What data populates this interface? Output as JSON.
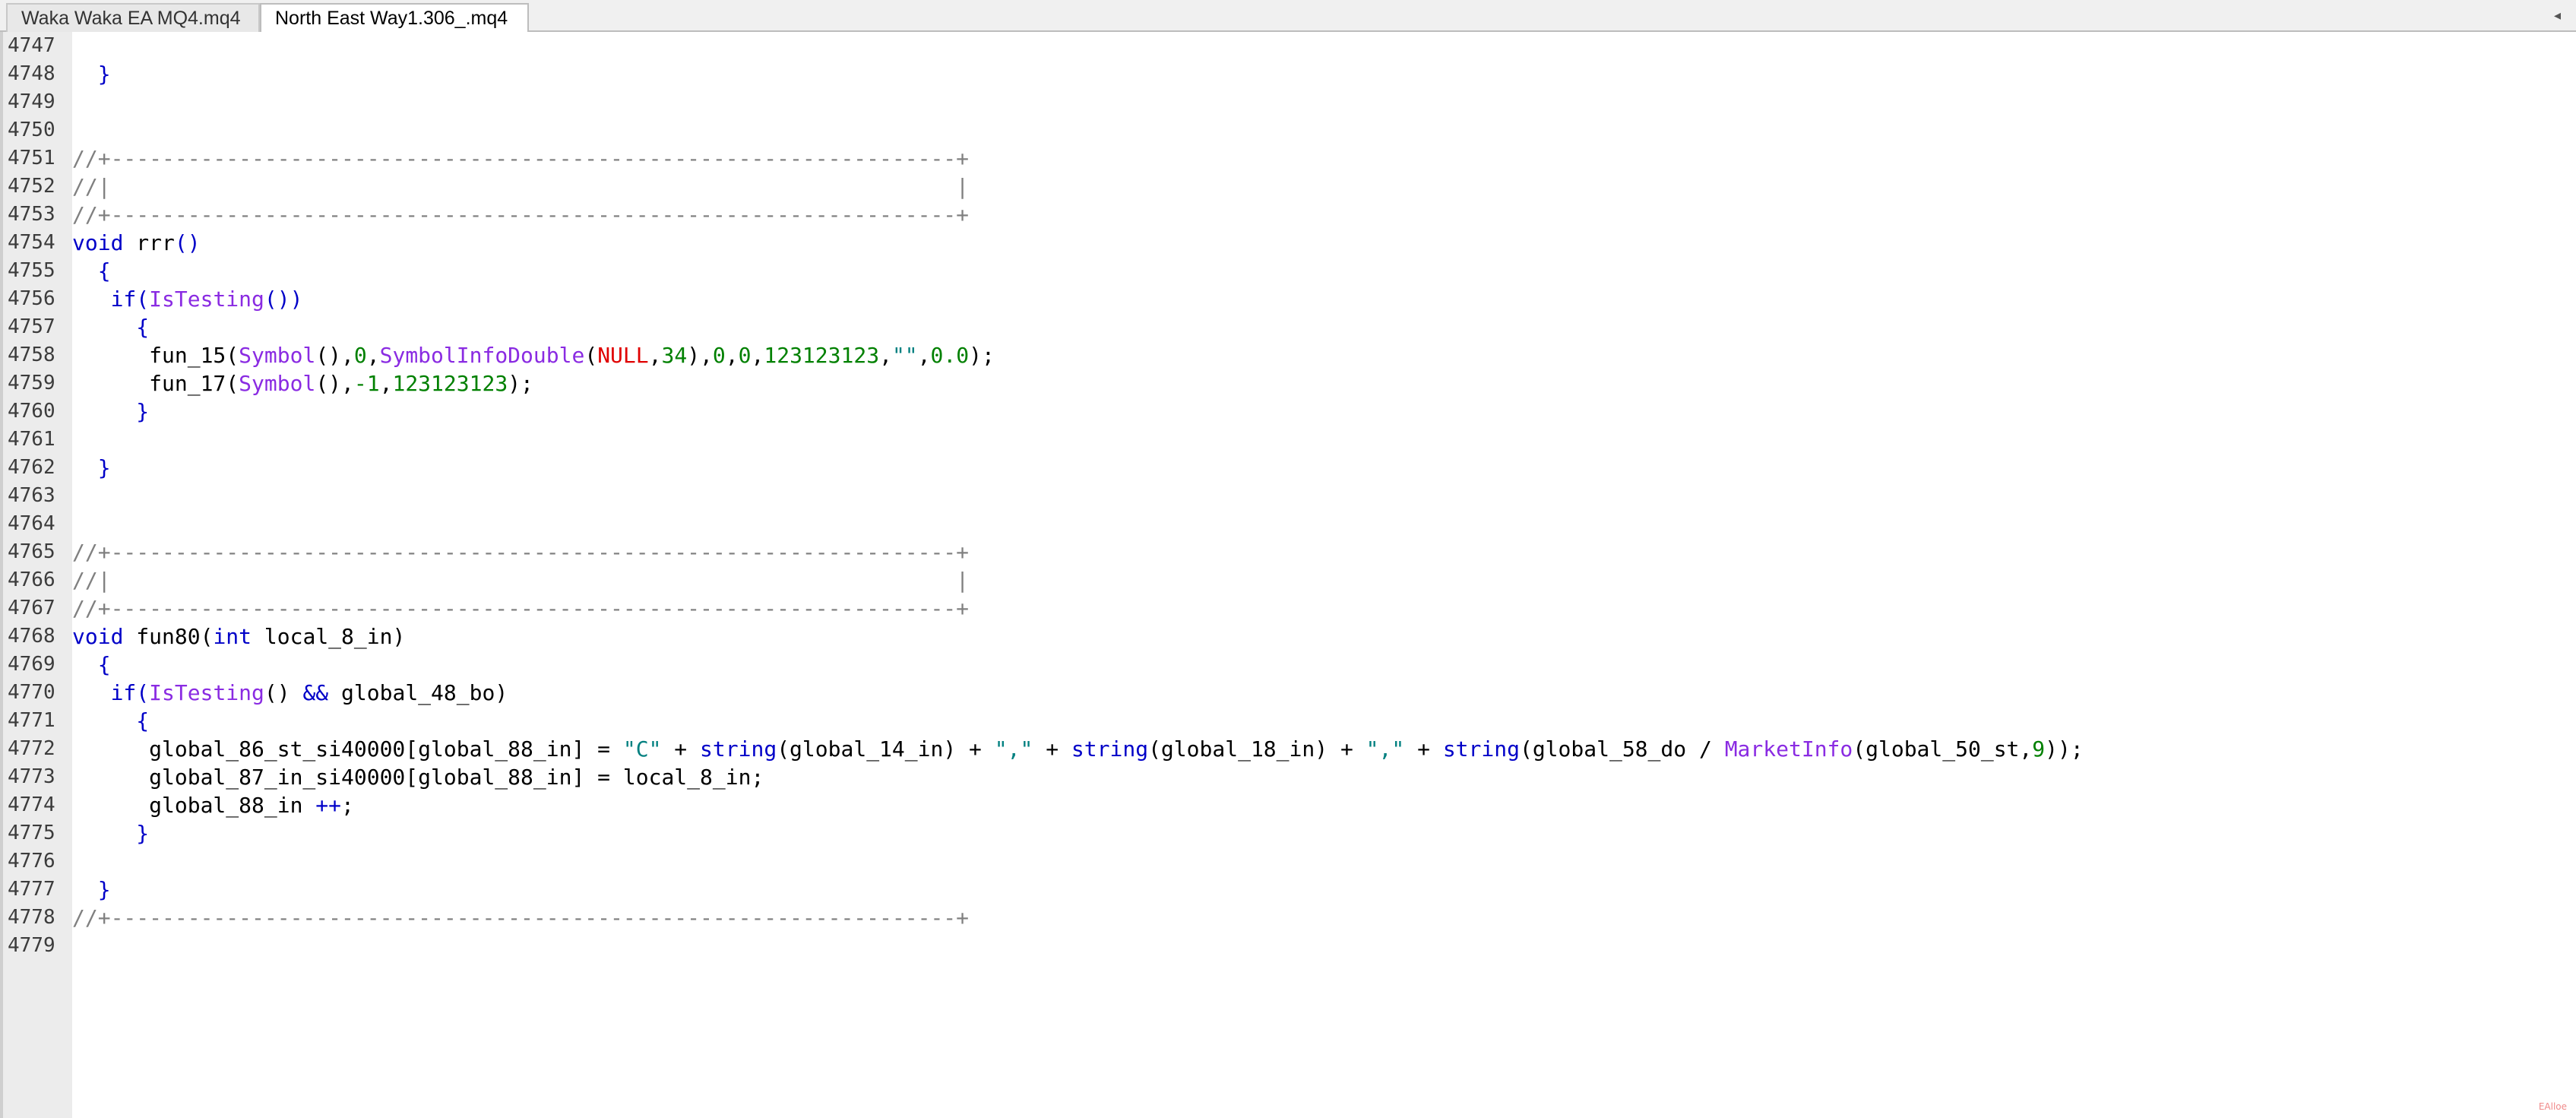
{
  "tabs": [
    {
      "label": "Waka Waka EA MQ4.mq4",
      "active": false
    },
    {
      "label": "North East Way1.306_.mq4",
      "active": true
    }
  ],
  "tab_scroll_arrow": "◂",
  "colors": {
    "plain": "#000000",
    "keyword": "#0000c8",
    "function": "#8a2be2",
    "number": "#008000",
    "string": "#008080",
    "constant": "#e00000",
    "comment": "#808080"
  },
  "lines": [
    {
      "n": "4747",
      "tokens": []
    },
    {
      "n": "4748",
      "tokens": [
        {
          "t": "  "
        },
        {
          "t": "}",
          "c": "keyword"
        }
      ]
    },
    {
      "n": "4749",
      "tokens": []
    },
    {
      "n": "4750",
      "tokens": []
    },
    {
      "n": "4751",
      "tokens": [
        {
          "t": "//+------------------------------------------------------------------+",
          "c": "comment"
        }
      ]
    },
    {
      "n": "4752",
      "tokens": [
        {
          "t": "//|                                                                  |",
          "c": "comment"
        }
      ]
    },
    {
      "n": "4753",
      "tokens": [
        {
          "t": "//+------------------------------------------------------------------+",
          "c": "comment"
        }
      ]
    },
    {
      "n": "4754",
      "tokens": [
        {
          "t": "void",
          "c": "keyword"
        },
        {
          "t": " rrr"
        },
        {
          "t": "()",
          "c": "keyword"
        }
      ]
    },
    {
      "n": "4755",
      "tokens": [
        {
          "t": "  "
        },
        {
          "t": "{",
          "c": "keyword"
        }
      ]
    },
    {
      "n": "4756",
      "tokens": [
        {
          "t": "   "
        },
        {
          "t": "if(",
          "c": "keyword"
        },
        {
          "t": "IsTesting",
          "c": "function"
        },
        {
          "t": "())",
          "c": "keyword"
        }
      ]
    },
    {
      "n": "4757",
      "tokens": [
        {
          "t": "     "
        },
        {
          "t": "{",
          "c": "keyword"
        }
      ]
    },
    {
      "n": "4758",
      "tokens": [
        {
          "t": "      fun_15("
        },
        {
          "t": "Symbol",
          "c": "function"
        },
        {
          "t": "(),"
        },
        {
          "t": "0",
          "c": "number"
        },
        {
          "t": ","
        },
        {
          "t": "SymbolInfoDouble",
          "c": "function"
        },
        {
          "t": "("
        },
        {
          "t": "NULL",
          "c": "constant"
        },
        {
          "t": ","
        },
        {
          "t": "34",
          "c": "number"
        },
        {
          "t": "),"
        },
        {
          "t": "0",
          "c": "number"
        },
        {
          "t": ","
        },
        {
          "t": "0",
          "c": "number"
        },
        {
          "t": ","
        },
        {
          "t": "123123123",
          "c": "number"
        },
        {
          "t": ","
        },
        {
          "t": "\"\"",
          "c": "string"
        },
        {
          "t": ","
        },
        {
          "t": "0.0",
          "c": "number"
        },
        {
          "t": ");"
        }
      ]
    },
    {
      "n": "4759",
      "tokens": [
        {
          "t": "      fun_17("
        },
        {
          "t": "Symbol",
          "c": "function"
        },
        {
          "t": "(),"
        },
        {
          "t": "-1",
          "c": "number"
        },
        {
          "t": ","
        },
        {
          "t": "123123123",
          "c": "number"
        },
        {
          "t": ");"
        }
      ]
    },
    {
      "n": "4760",
      "tokens": [
        {
          "t": "     "
        },
        {
          "t": "}",
          "c": "keyword"
        }
      ]
    },
    {
      "n": "4761",
      "tokens": []
    },
    {
      "n": "4762",
      "tokens": [
        {
          "t": "  "
        },
        {
          "t": "}",
          "c": "keyword"
        }
      ]
    },
    {
      "n": "4763",
      "tokens": []
    },
    {
      "n": "4764",
      "tokens": []
    },
    {
      "n": "4765",
      "tokens": [
        {
          "t": "//+------------------------------------------------------------------+",
          "c": "comment"
        }
      ]
    },
    {
      "n": "4766",
      "tokens": [
        {
          "t": "//|                                                                  |",
          "c": "comment"
        }
      ]
    },
    {
      "n": "4767",
      "tokens": [
        {
          "t": "//+------------------------------------------------------------------+",
          "c": "comment"
        }
      ]
    },
    {
      "n": "4768",
      "tokens": [
        {
          "t": "void",
          "c": "keyword"
        },
        {
          "t": " fun80("
        },
        {
          "t": "int",
          "c": "keyword"
        },
        {
          "t": " local_8_in)"
        }
      ]
    },
    {
      "n": "4769",
      "tokens": [
        {
          "t": "  "
        },
        {
          "t": "{",
          "c": "keyword"
        }
      ]
    },
    {
      "n": "4770",
      "tokens": [
        {
          "t": "   "
        },
        {
          "t": "if(",
          "c": "keyword"
        },
        {
          "t": "IsTesting",
          "c": "function"
        },
        {
          "t": "() "
        },
        {
          "t": "&&",
          "c": "keyword"
        },
        {
          "t": " global_48_bo)"
        }
      ]
    },
    {
      "n": "4771",
      "tokens": [
        {
          "t": "     "
        },
        {
          "t": "{",
          "c": "keyword"
        }
      ]
    },
    {
      "n": "4772",
      "tokens": [
        {
          "t": "      global_86_st_si40000[global_88_in] = "
        },
        {
          "t": "\"C\"",
          "c": "string"
        },
        {
          "t": " + "
        },
        {
          "t": "string",
          "c": "keyword"
        },
        {
          "t": "(global_14_in) + "
        },
        {
          "t": "\",\"",
          "c": "string"
        },
        {
          "t": " + "
        },
        {
          "t": "string",
          "c": "keyword"
        },
        {
          "t": "(global_18_in) + "
        },
        {
          "t": "\",\"",
          "c": "string"
        },
        {
          "t": " + "
        },
        {
          "t": "string",
          "c": "keyword"
        },
        {
          "t": "(global_58_do / "
        },
        {
          "t": "MarketInfo",
          "c": "function"
        },
        {
          "t": "(global_50_st,"
        },
        {
          "t": "9",
          "c": "number"
        },
        {
          "t": "));"
        }
      ]
    },
    {
      "n": "4773",
      "tokens": [
        {
          "t": "      global_87_in_si40000[global_88_in] = local_8_in;"
        }
      ]
    },
    {
      "n": "4774",
      "tokens": [
        {
          "t": "      global_88_in "
        },
        {
          "t": "++",
          "c": "keyword"
        },
        {
          "t": ";"
        }
      ]
    },
    {
      "n": "4775",
      "tokens": [
        {
          "t": "     "
        },
        {
          "t": "}",
          "c": "keyword"
        }
      ]
    },
    {
      "n": "4776",
      "tokens": []
    },
    {
      "n": "4777",
      "tokens": [
        {
          "t": "  "
        },
        {
          "t": "}",
          "c": "keyword"
        }
      ]
    },
    {
      "n": "4778",
      "tokens": [
        {
          "t": "//+------------------------------------------------------------------+",
          "c": "comment"
        }
      ]
    },
    {
      "n": "4779",
      "tokens": []
    }
  ],
  "watermark": "EAlloe"
}
